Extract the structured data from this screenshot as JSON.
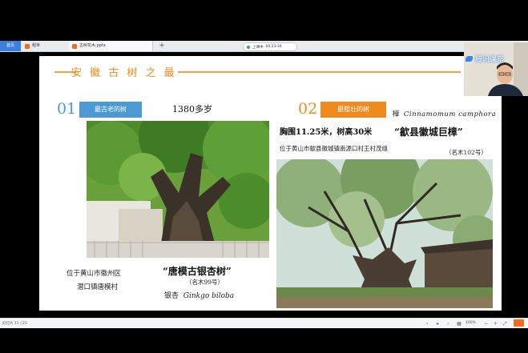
{
  "tabs": {
    "home": "首页",
    "doc": "稻米",
    "ppt": "古树花木.pptx",
    "add": "+"
  },
  "class_status": {
    "label": "上课中",
    "time": "00:23:34"
  },
  "slide": {
    "title": "安 徽 古 树 之 最",
    "item1": {
      "number": "01",
      "badge": "最古老的树",
      "age": "1380多岁",
      "location_line1": "位于黄山市徽州区",
      "location_line2": "潜口镇唐模村",
      "name": "“唐模古银杏树”",
      "name_no": "（名木99号）",
      "species_cn": "银杏",
      "species_latin": "Ginkgo biloba"
    },
    "item2": {
      "number": "02",
      "badge": "最粗壮的树",
      "species_cn": "樟",
      "species_latin": "Cinnamomum camphora",
      "girth": "胸围11.25米，树高30米",
      "name": "“歙县徽城巨樟”",
      "location": "位于黄山市歙县徽城镇南源口村王村茂组",
      "name_no": "（名木102号）"
    }
  },
  "webcam": {
    "brand": "腾讯课堂"
  },
  "bottom_bar": {
    "page": "幻灯片 11 / 23",
    "zoom": "100%"
  },
  "colors": {
    "accent_orange": "#f08a1c",
    "accent_blue": "#4b9ad6"
  }
}
